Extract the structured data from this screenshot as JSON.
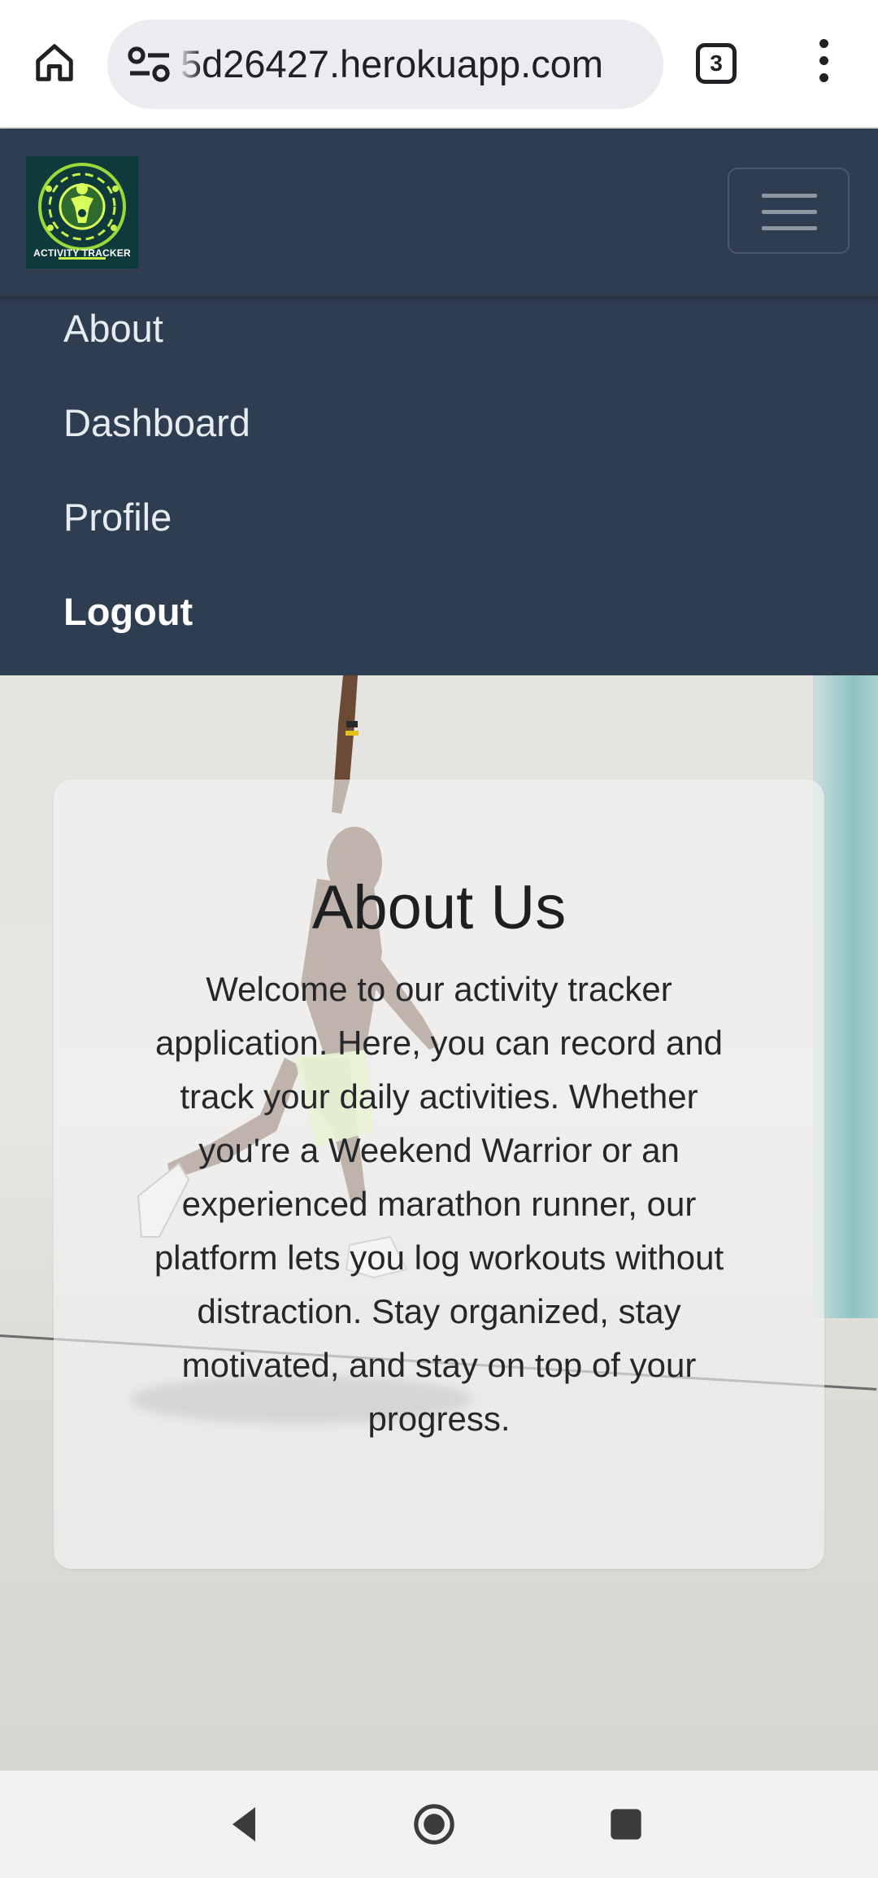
{
  "browser": {
    "url": "5d26427.herokuapp.com",
    "tab_count": "3"
  },
  "navbar": {
    "logo_text": "ACTIVITY TRACKER",
    "links": [
      {
        "label": "About"
      },
      {
        "label": "Dashboard"
      },
      {
        "label": "Profile"
      },
      {
        "label": "Logout"
      }
    ]
  },
  "about": {
    "title": "About Us",
    "body": "Welcome to our activity tracker application. Here, you can record and track your daily activities. Whether you're a Weekend Warrior or an experienced marathon runner, our platform lets you log workouts without distraction. Stay organized, stay motivated, and stay on top of your progress."
  },
  "colors": {
    "navbar_bg": "#2e3d4f",
    "nav_text": "#e7ecf1",
    "card_bg": "rgba(244,244,244,0.62)"
  }
}
